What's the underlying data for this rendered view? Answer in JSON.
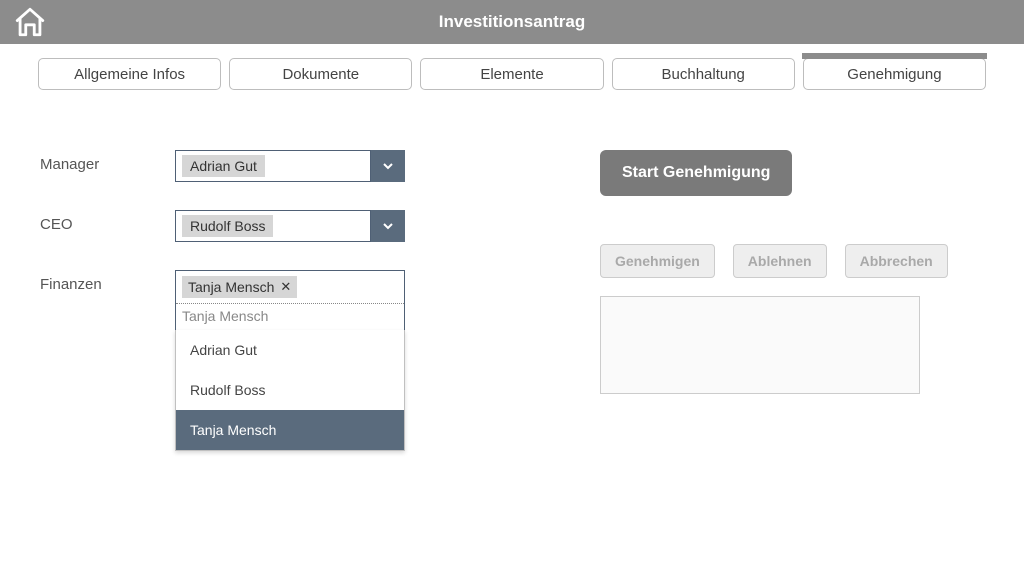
{
  "header": {
    "title": "Investitionsantrag"
  },
  "tabs": [
    {
      "label": "Allgemeine Infos",
      "active": false
    },
    {
      "label": "Dokumente",
      "active": false
    },
    {
      "label": "Elemente",
      "active": false
    },
    {
      "label": "Buchhaltung",
      "active": false
    },
    {
      "label": "Genehmigung",
      "active": true
    }
  ],
  "fields": {
    "manager": {
      "label": "Manager",
      "value": "Adrian Gut"
    },
    "ceo": {
      "label": "CEO",
      "value": "Rudolf Boss"
    },
    "finance": {
      "label": "Finanzen",
      "selected": [
        "Tanja Mensch"
      ],
      "input_text": "Tanja Mensch",
      "options": [
        {
          "label": "Adrian Gut",
          "highlight": false
        },
        {
          "label": "Rudolf Boss",
          "highlight": false
        },
        {
          "label": "Tanja Mensch",
          "highlight": true
        }
      ]
    }
  },
  "actions": {
    "start": "Start Genehmigung",
    "approve": "Genehmigen",
    "reject": "Ablehnen",
    "cancel": "Abbrechen"
  }
}
